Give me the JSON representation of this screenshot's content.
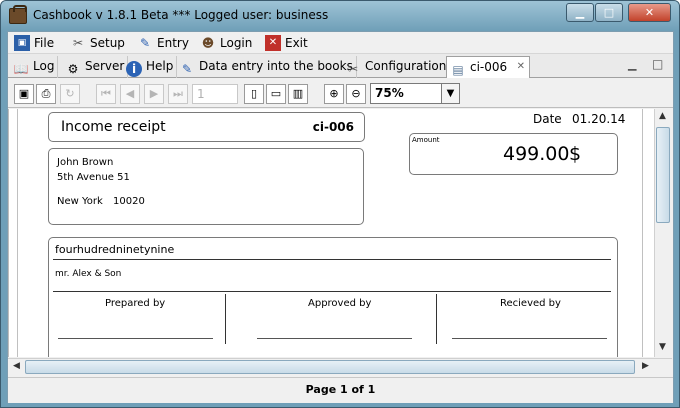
{
  "window": {
    "title": "Cashbook v 1.8.1 Beta  *** Logged user: business",
    "controls": {
      "minimize": "▁",
      "maximize": "□",
      "close": "✕"
    }
  },
  "menu": [
    {
      "label": "File",
      "icon": "floppy-icon"
    },
    {
      "label": "Setup",
      "icon": "tools-icon"
    },
    {
      "label": "Entry",
      "icon": "pencil-icon"
    },
    {
      "label": "Login",
      "icon": "user-icon"
    },
    {
      "label": "Exit",
      "icon": "close-red-icon"
    }
  ],
  "tabs": [
    {
      "label": "Log",
      "icon": "book-icon"
    },
    {
      "label": "Server",
      "icon": "server-icon"
    },
    {
      "label": "Help",
      "icon": "info-icon"
    },
    {
      "label": "Data entry into the books",
      "icon": "pencil-icon"
    },
    {
      "label": "Configuration",
      "icon": "tools-icon"
    },
    {
      "label": "ci-006",
      "icon": "document-icon",
      "close": "✕",
      "active": true
    }
  ],
  "toolbar": {
    "page_number": "1",
    "zoom": "75%"
  },
  "receipt": {
    "title": "Income receipt",
    "number": "ci-006",
    "date_label": "Date",
    "date": "01.20.14",
    "amount_label": "Amount",
    "amount": "499.00",
    "currency": "$",
    "address": {
      "name": "John Brown",
      "street": "5th Avenue 51",
      "city": "New York",
      "zip": "10020"
    },
    "amount_words": "fourhudredninetynine",
    "payer": "mr. Alex & Son",
    "signatures": [
      "Prepared by",
      "Approved by",
      "Recieved by"
    ]
  },
  "status": {
    "page_info": "Page 1 of 1"
  }
}
